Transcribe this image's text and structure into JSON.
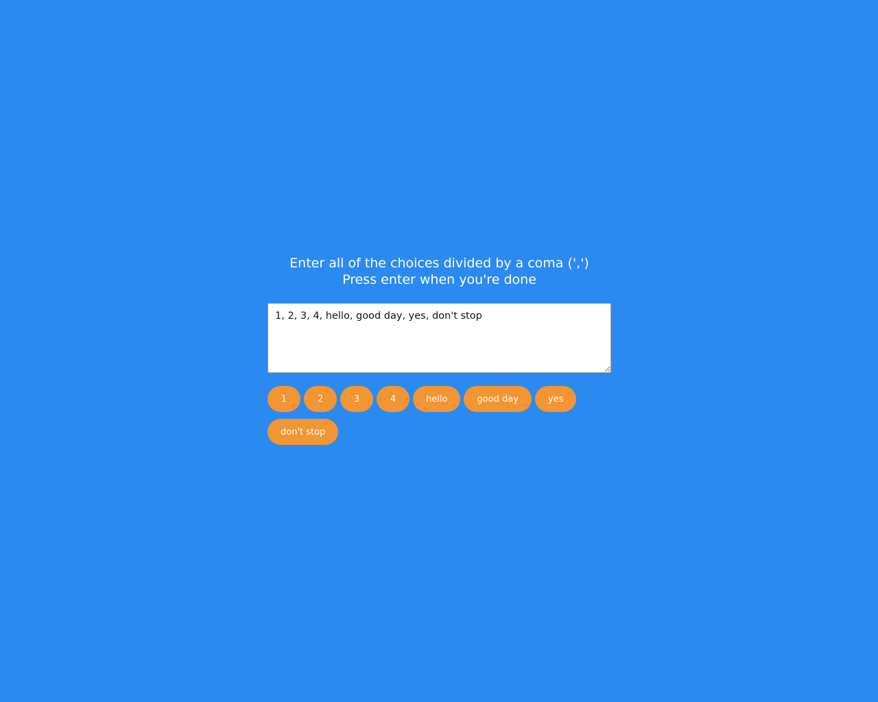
{
  "instructions": {
    "line1": "Enter all of the choices divided by a coma (',')",
    "line2": "Press enter when you're done"
  },
  "input": {
    "value": "1, 2, 3, 4, hello, good day, yes, don't stop"
  },
  "tags": [
    "1",
    "2",
    "3",
    "4",
    "hello",
    "good day",
    "yes",
    "don't stop"
  ],
  "colors": {
    "background": "#2b8af0",
    "tag": "#f39532"
  }
}
